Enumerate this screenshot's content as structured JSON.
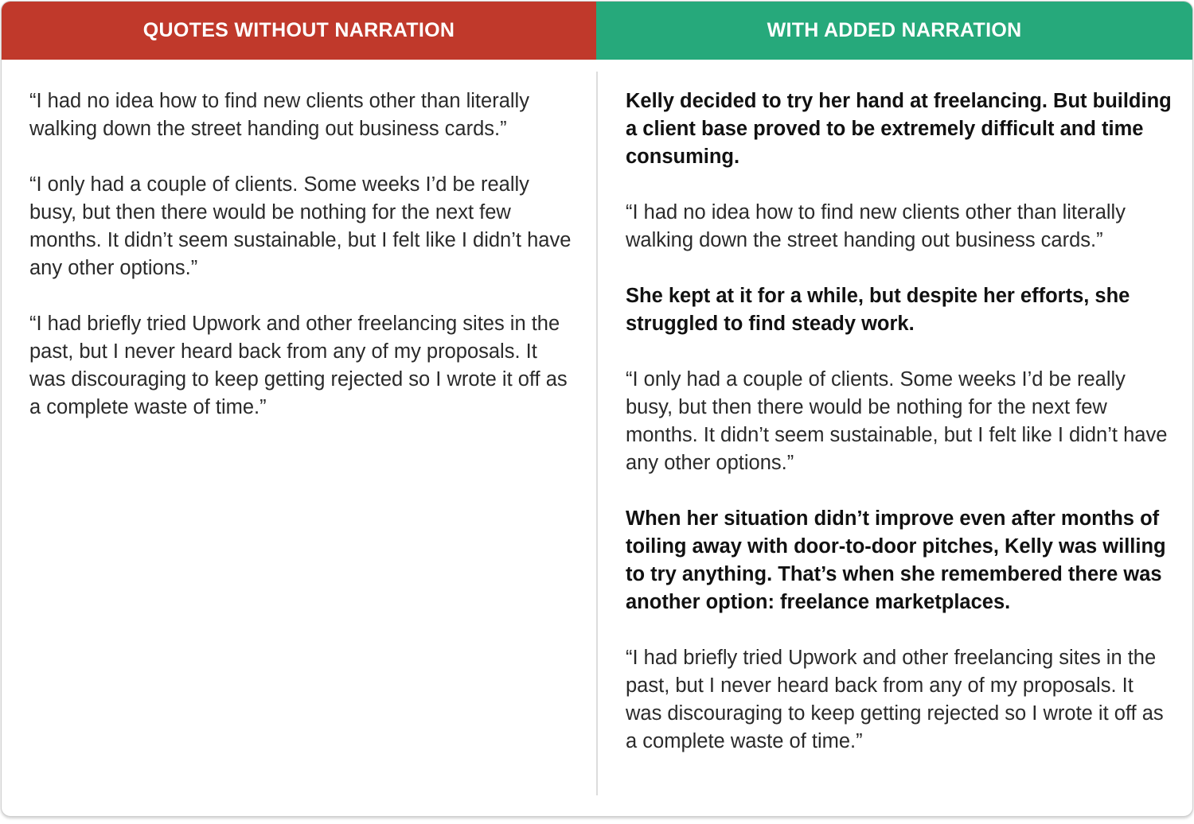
{
  "colors": {
    "left_header_bg": "#c0392b",
    "right_header_bg": "#26a97b",
    "header_text": "#ffffff",
    "divider": "#dcdcdc"
  },
  "left": {
    "header": "QUOTES WITHOUT NARRATION",
    "paragraphs": [
      "“I had no idea how to find new clients other than literally walking down the street handing out business cards.”",
      "“I only had a couple of clients. Some weeks I’d be really busy, but then there would be nothing for the next few months. It didn’t seem sustainable, but I felt like I didn’t have any other options.”",
      "“I had briefly tried Upwork and other freelancing sites in the past, but I never heard back from any of my proposals. It was discouraging to keep getting rejected so I wrote it off as a complete waste of time.”"
    ]
  },
  "right": {
    "header": "WITH ADDED NARRATION",
    "paragraphs": [
      "Kelly decided to try her hand at freelancing. But building a client base proved to be extremely difficult and time consuming.",
      "“I had no idea how to find new clients other than literally walking down the street handing out business cards.”",
      "She kept at it for a while, but despite her efforts, she struggled to find steady work.",
      "“I only had a couple of clients. Some weeks I’d be really busy, but then there would be nothing for the next few months. It didn’t seem sustainable, but I felt like I didn’t have any other options.”",
      "When her situation didn’t improve even after months of toiling away with door-to-door pitches, Kelly was willing to try anything. That’s when she remembered there was another option: freelance marketplaces.",
      "“I had briefly tried Upwork and other freelancing sites in the past, but I never heard back from any of my proposals. It was discouraging to keep getting rejected so I wrote it off as a complete waste of time.”"
    ]
  }
}
